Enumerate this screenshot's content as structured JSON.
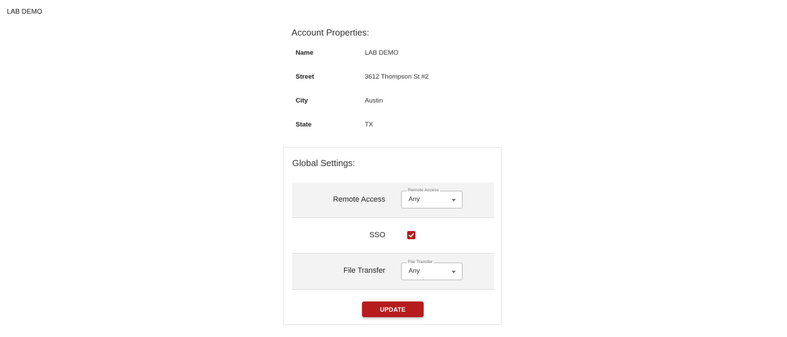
{
  "header": {
    "account_name": "LAB DEMO"
  },
  "account_properties": {
    "title": "Account Properties:",
    "rows": [
      {
        "label": "Name",
        "value": "LAB DEMO"
      },
      {
        "label": "Street",
        "value": "3612 Thompson St #2"
      },
      {
        "label": "City",
        "value": "Austin"
      },
      {
        "label": "State",
        "value": "TX"
      }
    ]
  },
  "global_settings": {
    "title": "Global Settings:",
    "remote_access": {
      "label": "Remote Access",
      "field_legend": "Remote Access",
      "selected": "Any"
    },
    "sso": {
      "label": "SSO",
      "checked": true
    },
    "file_transfer": {
      "label": "File Transfer",
      "field_legend": "File Transfer",
      "selected": "Any"
    },
    "update_label": "UPDATE"
  },
  "colors": {
    "accent": "#b71c1c",
    "row_shade": "#f3f3f3"
  },
  "icons": {
    "checkbox": "check-icon",
    "dropdown": "caret-down-icon"
  }
}
